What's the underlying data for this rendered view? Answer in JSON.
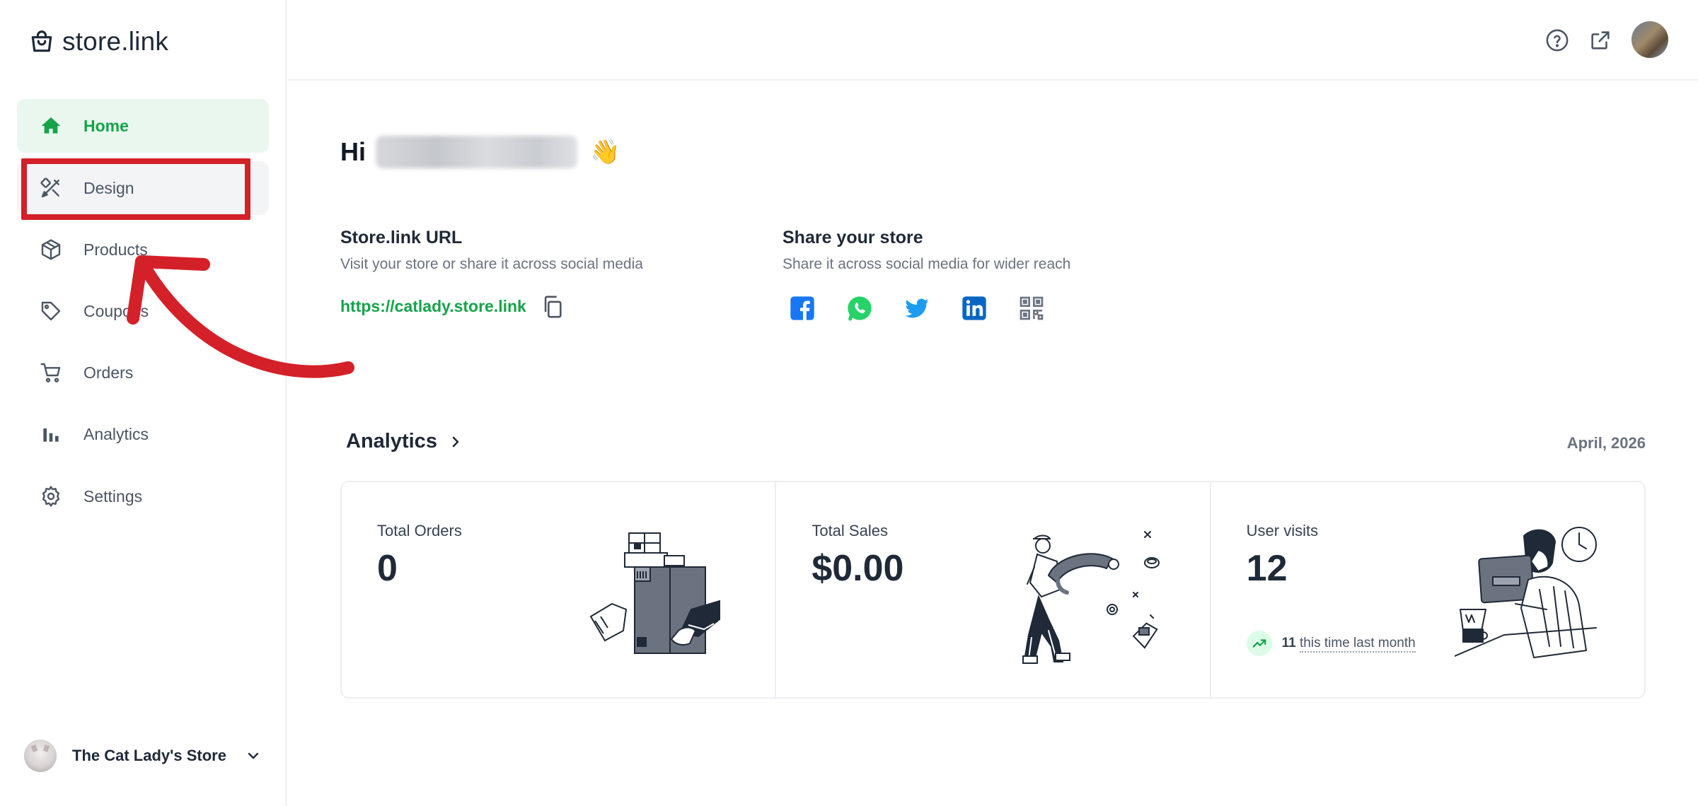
{
  "app": {
    "logo_text": "store.link"
  },
  "sidebar": {
    "items": [
      {
        "label": "Home",
        "icon": "home-icon",
        "state": "active"
      },
      {
        "label": "Design",
        "icon": "design-tools-icon",
        "state": "hover"
      },
      {
        "label": "Products",
        "icon": "box-icon",
        "state": "normal"
      },
      {
        "label": "Coupons",
        "icon": "tag-icon",
        "state": "normal"
      },
      {
        "label": "Orders",
        "icon": "cart-icon",
        "state": "normal"
      },
      {
        "label": "Analytics",
        "icon": "bar-chart-icon",
        "state": "normal"
      },
      {
        "label": "Settings",
        "icon": "gear-icon",
        "state": "normal"
      }
    ],
    "store_name": "The Cat Lady's Store"
  },
  "header": {
    "icons": [
      "help-icon",
      "external-link-icon",
      "user-avatar"
    ]
  },
  "main": {
    "greeting_prefix": "Hi",
    "greeting_emoji": "👋",
    "store_url": {
      "title": "Store.link URL",
      "subtitle": "Visit your store or share it across social media",
      "url": "https://catlady.store.link"
    },
    "share": {
      "title": "Share your store",
      "subtitle": "Share it across social media for wider reach",
      "networks": [
        "facebook-icon",
        "whatsapp-icon",
        "twitter-icon",
        "linkedin-icon",
        "qr-code-icon"
      ]
    },
    "analytics": {
      "title": "Analytics",
      "period": "April, 2026",
      "cards": [
        {
          "label": "Total Orders",
          "value": "0"
        },
        {
          "label": "Total Sales",
          "value": "$0.00"
        },
        {
          "label": "User visits",
          "value": "12",
          "trend_value": "11",
          "trend_text": "this time last month"
        }
      ]
    }
  },
  "colors": {
    "accent_green": "#16a34a",
    "active_bg": "#e9f7ee",
    "annotation_red": "#d42028"
  }
}
